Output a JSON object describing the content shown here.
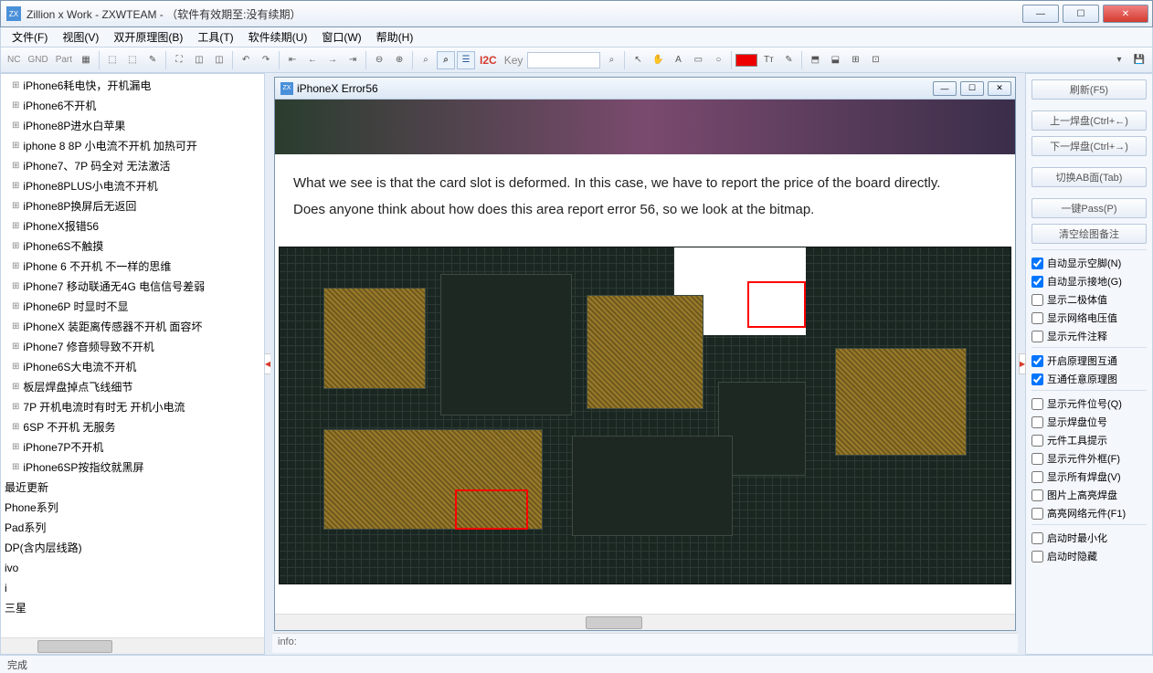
{
  "window": {
    "title": "Zillion x Work - ZXWTEAM - （软件有效期至:没有续期）"
  },
  "menu": [
    "文件(F)",
    "视图(V)",
    "双开原理图(B)",
    "工具(T)",
    "软件续期(U)",
    "窗口(W)",
    "帮助(H)"
  ],
  "toolbar": {
    "nc": "NC",
    "gnd": "GND",
    "part": "Part",
    "i2c": "I2C",
    "key": "Key"
  },
  "tree": {
    "items": [
      "iPhone6耗电快，开机漏电",
      "iPhone6不开机",
      "iPhone8P进水白苹果",
      "iphone  8 8P 小电流不开机  加热可开",
      "iPhone7、7P 码全对 无法激活",
      "iPhone8PLUS小电流不开机",
      "iPhone8P换屏后无返回",
      "iPhoneX报错56",
      "iPhone6S不触摸",
      "iPhone 6 不开机 不一样的思维",
      "iPhone7 移动联通无4G 电信信号差弱",
      "iPhone6P 时显时不显",
      "iPhoneX 装距离传感器不开机 面容坏",
      "iPhone7 修音频导致不开机",
      "iPhone6S大电流不开机",
      "板层焊盘掉点飞线细节",
      "7P 开机电流时有时无 开机小电流",
      "6SP 不开机 无服务",
      "iPhone7P不开机",
      "iPhone6SP按指纹就黑屏"
    ],
    "categories": [
      "最近更新",
      "Phone系列",
      "Pad系列",
      "DP(含内层线路)",
      "ivo",
      "i",
      "三星"
    ]
  },
  "doc": {
    "title": "iPhoneX Error56",
    "para1": "What we see is that the card slot is deformed. In this case, we have to report the price of the board directly.",
    "para2": "Does anyone think about how does this area report error 56, so we look at the bitmap."
  },
  "info_label": "info:",
  "right": {
    "buttons": [
      "刷新(F5)",
      "上一焊盘(Ctrl+←)",
      "下一焊盘(Ctrl+→)",
      "切换AB面(Tab)",
      "一键Pass(P)",
      "清空绘图备注"
    ],
    "checks1": [
      {
        "label": "自动显示空脚(N)",
        "on": true
      },
      {
        "label": "自动显示接地(G)",
        "on": true
      },
      {
        "label": "显示二极体值",
        "on": false
      },
      {
        "label": "显示网络电压值",
        "on": false
      },
      {
        "label": "显示元件注释",
        "on": false
      }
    ],
    "checks2": [
      {
        "label": "开启原理图互通",
        "on": true
      },
      {
        "label": "互通任意原理图",
        "on": true
      }
    ],
    "checks3": [
      {
        "label": "显示元件位号(Q)",
        "on": false
      },
      {
        "label": "显示焊盘位号",
        "on": false
      },
      {
        "label": "元件工具提示",
        "on": false
      },
      {
        "label": "显示元件外框(F)",
        "on": false
      },
      {
        "label": "显示所有焊盘(V)",
        "on": false
      },
      {
        "label": "图片上高亮焊盘",
        "on": false
      },
      {
        "label": "高亮网络元件(F1)",
        "on": false
      }
    ],
    "checks4": [
      {
        "label": "启动时最小化",
        "on": false
      },
      {
        "label": "启动时隐藏",
        "on": false
      }
    ]
  },
  "status": "完成"
}
